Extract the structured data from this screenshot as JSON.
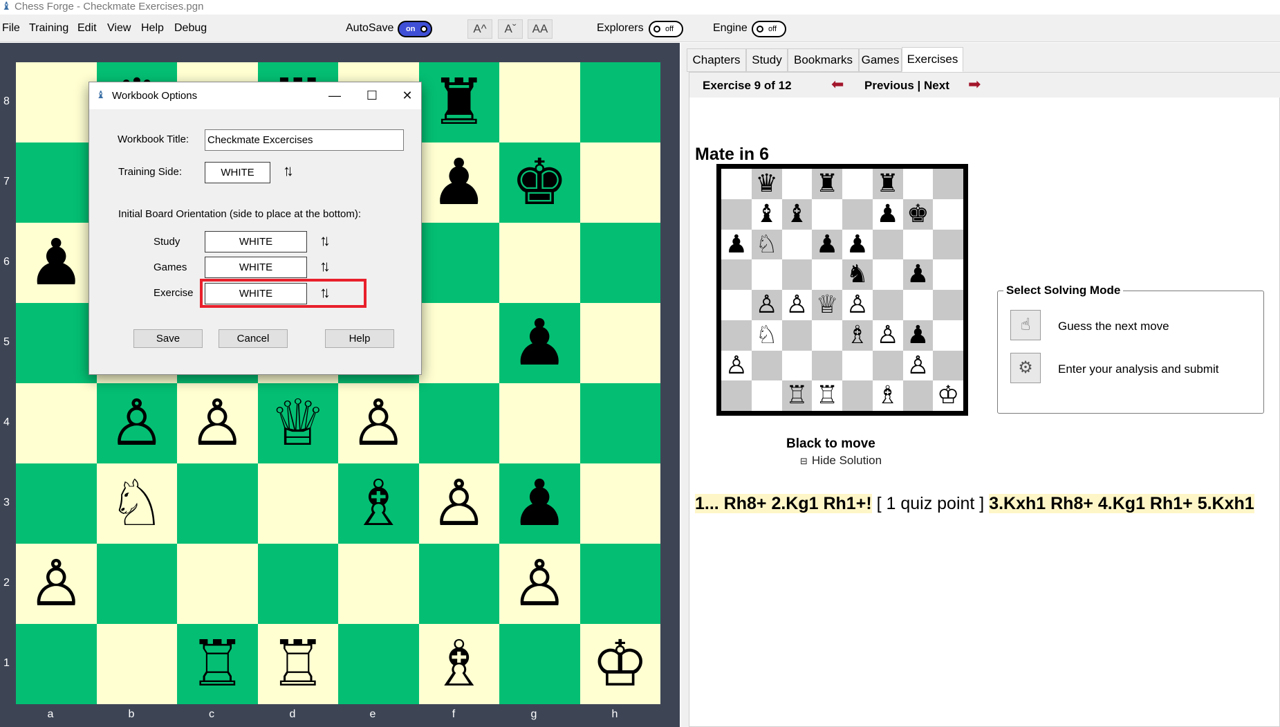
{
  "window": {
    "title": "Chess Forge - Checkmate Exercises.pgn"
  },
  "menu": {
    "items": [
      "File",
      "Training",
      "Edit",
      "View",
      "Help",
      "Debug"
    ],
    "autosave_label": "AutoSave",
    "autosave_state": "on",
    "explorers_label": "Explorers",
    "explorers_state": "off",
    "engine_label": "Engine",
    "engine_state": "off",
    "font_buttons": [
      "A^",
      "Aˇ",
      "AA"
    ]
  },
  "board": {
    "ranks": [
      "8",
      "7",
      "6",
      "5",
      "4",
      "3",
      "2",
      "1"
    ],
    "files": [
      "a",
      "b",
      "c",
      "d",
      "e",
      "f",
      "g",
      "h"
    ],
    "light_color": "#ffffd2",
    "dark_color": "#04bf73",
    "position": [
      [
        "",
        "♛",
        "",
        "♜",
        "",
        "♜",
        "",
        ""
      ],
      [
        "",
        "♝",
        "♝",
        "",
        "",
        "♟",
        "♚",
        ""
      ],
      [
        "♟",
        "♘",
        "",
        "♟",
        "♟",
        "",
        "",
        ""
      ],
      [
        "",
        "",
        "",
        "",
        "♞",
        "",
        "♟",
        ""
      ],
      [
        "",
        "♙",
        "♙",
        "♕",
        "♙",
        "",
        "",
        ""
      ],
      [
        "",
        "♘",
        "",
        "",
        "♗",
        "♙",
        "♟",
        ""
      ],
      [
        "♙",
        "",
        "",
        "",
        "",
        "",
        "♙",
        ""
      ],
      [
        "",
        "",
        "♖",
        "♖",
        "",
        "♗",
        "",
        "♔"
      ]
    ]
  },
  "tabs": [
    "Chapters",
    "Study",
    "Bookmarks",
    "Games",
    "Exercises"
  ],
  "active_tab": "Exercises",
  "exercise": {
    "counter": "Exercise 9 of 12",
    "nav": "Previous | Next",
    "title": "Mate in 6",
    "side_to_move": "Black to move",
    "hide_solution": "Hide Solution",
    "solution": {
      "move1": "1... Rh8+ 2.Kg1 Rh1+!",
      "quiz": " [ 1 quiz point ] ",
      "move2": "3.Kxh1 Rh8+ 4.Kg1 Rh1+ 5.Kxh1"
    }
  },
  "solving_mode": {
    "title": "Select Solving Mode",
    "options": [
      "Guess the next move",
      "Enter your analysis and submit"
    ]
  },
  "dialog": {
    "title": "Workbook Options",
    "workbook_title_label": "Workbook Title:",
    "workbook_title_value": "Checkmate Excercises",
    "training_side_label": "Training Side:",
    "training_side_value": "WHITE",
    "orientation_label": "Initial Board Orientation (side to place at the bottom):",
    "study_label": "Study",
    "study_value": "WHITE",
    "games_label": "Games",
    "games_value": "WHITE",
    "exercise_label": "Exercise",
    "exercise_value": "WHITE",
    "save_label": "Save",
    "cancel_label": "Cancel",
    "help_label": "Help"
  },
  "colors": {
    "accent_toggle": "#3f4fd6",
    "nav_arrow": "#a3162b",
    "highlight_box": "#e8202b",
    "board_frame": "#3d4555"
  }
}
